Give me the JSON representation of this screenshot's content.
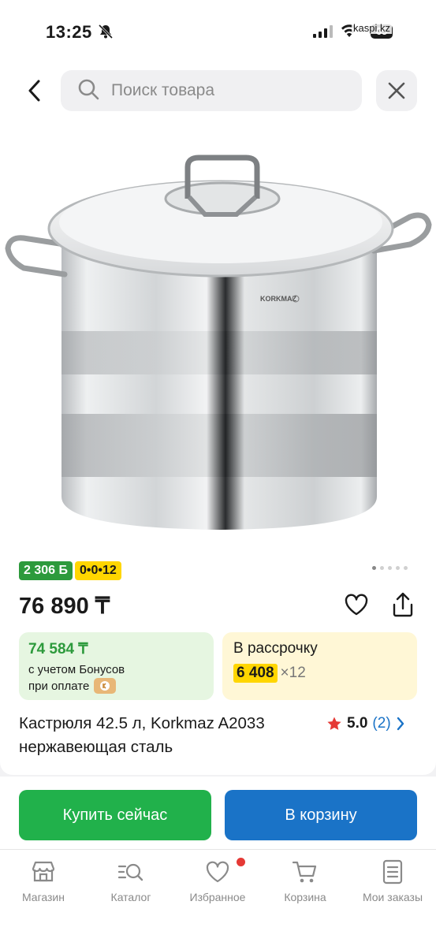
{
  "status_bar": {
    "time": "13:25",
    "battery": "65",
    "site": "kaspi.kz"
  },
  "search": {
    "placeholder": "Поиск товара"
  },
  "product": {
    "image_alt": "Кастрюля Korkmaz",
    "brand_mark": "KORKMAZ",
    "bonus_badge": "2 306 Б",
    "installment_badge": "0•0•12",
    "price": "76 890 ₸",
    "bonus_price": "74 584 ₸",
    "bonus_line1": "с учетом Бонусов",
    "bonus_line2": "при оплате",
    "installment_title": "В рассрочку",
    "installment_amount": "6 408",
    "installment_multiplier": "×12",
    "title": "Кастрюля 42.5 л, Korkmaz A2033 нержавеющая сталь",
    "rating": "5.0",
    "reviews": "(2)",
    "gallery_count": 5,
    "gallery_active": 1
  },
  "actions": {
    "buy_now": "Купить сейчас",
    "add_to_cart": "В корзину"
  },
  "tabbar": {
    "items": [
      {
        "label": "Магазин",
        "icon": "shop-icon"
      },
      {
        "label": "Каталог",
        "icon": "catalog-search-icon"
      },
      {
        "label": "Избранное",
        "icon": "heart-icon",
        "notification": true
      },
      {
        "label": "Корзина",
        "icon": "cart-icon"
      },
      {
        "label": "Мои заказы",
        "icon": "orders-icon"
      }
    ]
  },
  "colors": {
    "green": "#21b14b",
    "blue": "#1a73c7",
    "yellow": "#ffd600",
    "bonus_green": "#2d9a3c"
  }
}
